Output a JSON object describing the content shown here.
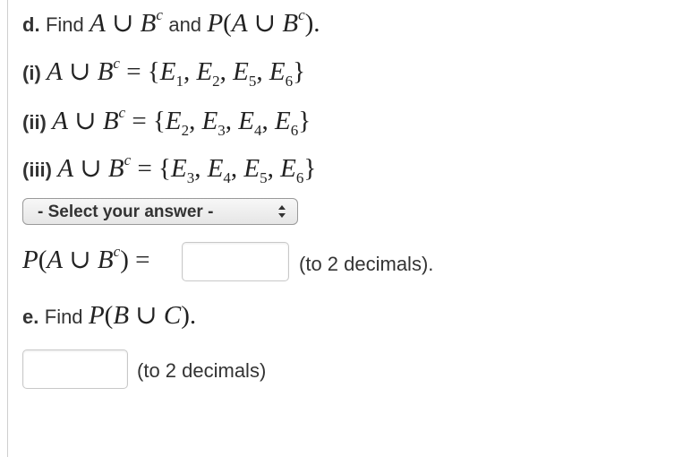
{
  "part_d": {
    "label": "d.",
    "prompt_text": "Find",
    "prompt_and": "and",
    "expr": {
      "A": "A",
      "cup": "∪",
      "B": "B",
      "c": "c",
      "P": "P",
      "lparen": "(",
      "rparen": ")",
      "period": "."
    }
  },
  "options": [
    {
      "label": "(i)",
      "set": [
        "E",
        "1",
        "E",
        "2",
        "E",
        "5",
        "E",
        "6"
      ]
    },
    {
      "label": "(ii)",
      "set": [
        "E",
        "2",
        "E",
        "3",
        "E",
        "4",
        "E",
        "6"
      ]
    },
    {
      "label": "(iii)",
      "set": [
        "E",
        "3",
        "E",
        "4",
        "E",
        "5",
        "E",
        "6"
      ]
    }
  ],
  "select": {
    "value": "- Select your answer -"
  },
  "prob_d": {
    "suffix": "(to 2 decimals).",
    "value": ""
  },
  "part_e": {
    "label": "e.",
    "prompt_text": "Find",
    "expr": {
      "P": "P",
      "B": "B",
      "cup": "∪",
      "C": "C"
    },
    "suffix": "(to 2 decimals)",
    "value": ""
  }
}
